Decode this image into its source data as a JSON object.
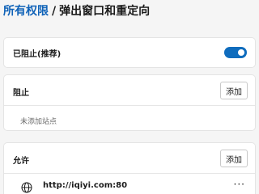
{
  "breadcrumb": {
    "parent": "所有权限",
    "separator": "/",
    "current": "弹出窗口和重定向"
  },
  "toggle": {
    "label": "已阻止(推荐)",
    "state": "on",
    "color": "#0f6cbd"
  },
  "block_section": {
    "title": "阻止",
    "add_label": "添加",
    "empty_text": "未添加站点"
  },
  "allow_section": {
    "title": "允许",
    "add_label": "添加",
    "sites": [
      {
        "icon": "globe-icon",
        "url": "http://iqiyi.com:80",
        "more": "···"
      }
    ]
  },
  "colors": {
    "link": "#0f62b8",
    "background": "#f5f5f5"
  }
}
